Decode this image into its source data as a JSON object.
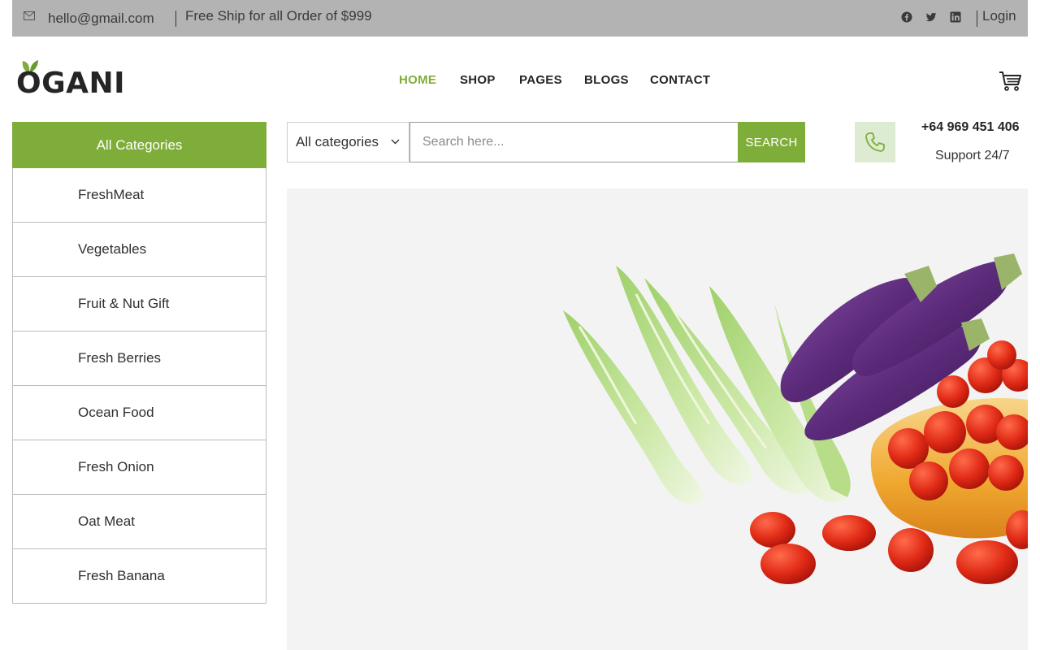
{
  "topbar": {
    "email": "hello@gmail.com",
    "shipping_text": "Free Ship for all Order of $999",
    "social_icons": [
      "facebook-icon",
      "twitter-icon",
      "linkedin-icon"
    ],
    "login_label": "Login"
  },
  "header": {
    "logo_text": "OGANI",
    "nav": [
      {
        "label": "HOME",
        "active": true
      },
      {
        "label": "SHOP",
        "active": false
      },
      {
        "label": "PAGES",
        "active": false
      },
      {
        "label": "BLOGS",
        "active": false
      },
      {
        "label": "CONTACT",
        "active": false
      }
    ],
    "cart_icon": "cart-icon"
  },
  "sidebar": {
    "title": "All Categories",
    "items": [
      {
        "label": "FreshMeat"
      },
      {
        "label": "Vegetables"
      },
      {
        "label": "Fruit & Nut Gift"
      },
      {
        "label": "Fresh Berries"
      },
      {
        "label": "Ocean Food"
      },
      {
        "label": "Fresh Onion"
      },
      {
        "label": "Oat Meat"
      },
      {
        "label": "Fresh Banana"
      }
    ]
  },
  "search": {
    "category_selected": "All categories",
    "placeholder": "Search here...",
    "button_label": "SEARCH"
  },
  "contact": {
    "phone": "+64 969 451 406",
    "support": "Support 24/7"
  },
  "colors": {
    "accent": "#7fad39",
    "topbar_bg": "#b3b3b3",
    "phone_bg": "#dcebd2",
    "hero_bg": "#f3f3f3"
  }
}
